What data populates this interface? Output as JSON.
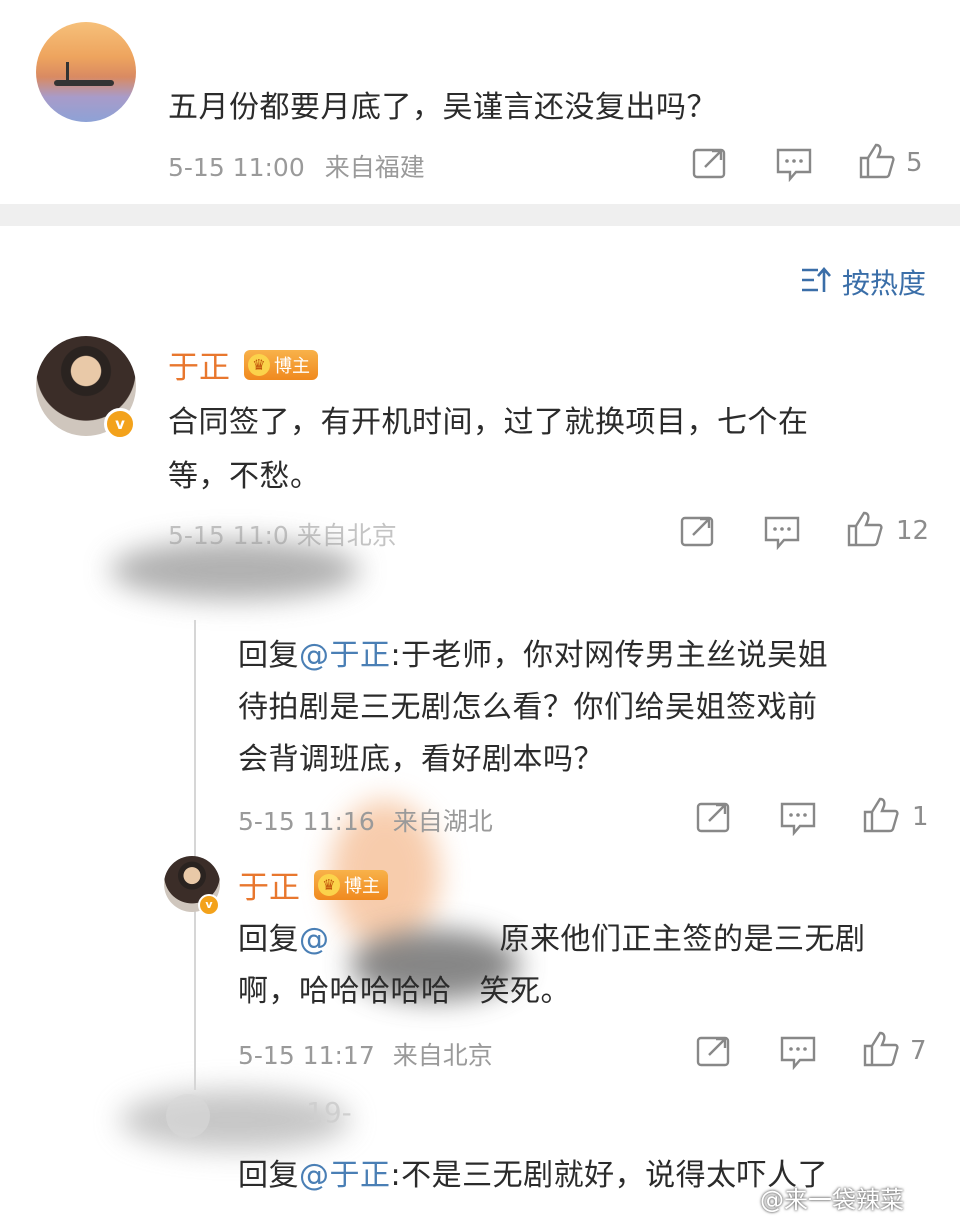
{
  "post": {
    "text": "五月份都要月底了，吴谨言还没复出吗？",
    "time": "5-15 11:00",
    "location": "来自福建",
    "like_count": "5"
  },
  "sort": {
    "label": "按热度",
    "icon": "sort-icon"
  },
  "comments": [
    {
      "name": "于正",
      "badge": "博主",
      "verified_icon": "v",
      "text_line1": "合同签了，有开机时间，过了就换项目，七个在",
      "text_line2": "等，不愁。",
      "meta": "5-15 11:0  来自北京",
      "like_count": "12"
    }
  ],
  "replies": [
    {
      "reply_prefix": "回复",
      "mention": "@于正",
      "line1": ":于老师，你对网传男主丝说吴姐",
      "line2": "待拍剧是三无剧怎么看？你们给吴姐签戏前",
      "line3": "会背调班底，看好剧本吗？",
      "time": "5-15 11:16",
      "location": "来自湖北",
      "like_count": "1"
    },
    {
      "name": "于正",
      "badge": "博主",
      "reply_prefix": "回复",
      "mention": "@",
      "line1_tail": "原来他们正主签的是三无剧",
      "line2a": "啊，哈哈哈哈哈",
      "line2b": "笑死。",
      "time": "5-15 11:17",
      "location": "来自北京",
      "like_count": "7"
    },
    {
      "name_partial": "19-",
      "reply_prefix": "回复",
      "mention": "@于正",
      "line1": ":不是三无剧就好，说得太吓人了"
    }
  ],
  "watermark": "@来一袋辣菜",
  "icons": [
    "share-icon",
    "comment-icon",
    "like-icon"
  ],
  "colors": {
    "name": "#e8772e",
    "mention": "#4a7fb5",
    "meta": "#9a9a9a",
    "divider": "#efefef"
  }
}
